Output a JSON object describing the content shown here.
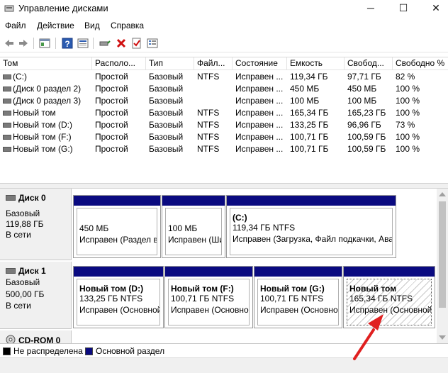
{
  "window": {
    "title": "Управление дисками",
    "minimize": "─",
    "maximize": "☐",
    "close": "✕"
  },
  "menu": [
    "Файл",
    "Действие",
    "Вид",
    "Справка"
  ],
  "volume_list": {
    "columns": [
      "Том",
      "Располо...",
      "Тип",
      "Файл...",
      "Состояние",
      "Емкость",
      "Свобод...",
      "Свободно %"
    ],
    "rows": [
      [
        "(C:)",
        "Простой",
        "Базовый",
        "NTFS",
        "Исправен ...",
        "119,34 ГБ",
        "97,71 ГБ",
        "82 %"
      ],
      [
        "(Диск 0 раздел 2)",
        "Простой",
        "Базовый",
        "",
        "Исправен ...",
        "450 МБ",
        "450 МБ",
        "100 %"
      ],
      [
        "(Диск 0 раздел 3)",
        "Простой",
        "Базовый",
        "",
        "Исправен ...",
        "100 МБ",
        "100 МБ",
        "100 %"
      ],
      [
        "Новый том",
        "Простой",
        "Базовый",
        "NTFS",
        "Исправен ...",
        "165,34 ГБ",
        "165,23 ГБ",
        "100 %"
      ],
      [
        "Новый том (D:)",
        "Простой",
        "Базовый",
        "NTFS",
        "Исправен ...",
        "133,25 ГБ",
        "96,96 ГБ",
        "73 %"
      ],
      [
        "Новый том (F:)",
        "Простой",
        "Базовый",
        "NTFS",
        "Исправен ...",
        "100,71 ГБ",
        "100,59 ГБ",
        "100 %"
      ],
      [
        "Новый том (G:)",
        "Простой",
        "Базовый",
        "NTFS",
        "Исправен ...",
        "100,71 ГБ",
        "100,59 ГБ",
        "100 %"
      ]
    ]
  },
  "disks": [
    {
      "name": "Диск 0",
      "type": "Базовый",
      "size": "119,88 ГБ",
      "status": "В сети",
      "partitions": [
        {
          "title": "",
          "size": "450 МБ",
          "status": "Исправен (Раздел в"
        },
        {
          "title": "",
          "size": "100 МБ",
          "status": "Исправен (Ши"
        },
        {
          "title": "(C:)",
          "size": "119,34 ГБ NTFS",
          "status": "Исправен (Загрузка, Файл подкачки, Ава"
        }
      ]
    },
    {
      "name": "Диск 1",
      "type": "Базовый",
      "size": "500,00 ГБ",
      "status": "В сети",
      "partitions": [
        {
          "title": "Новый том (D:)",
          "size": "133,25 ГБ NTFS",
          "status": "Исправен (Основной"
        },
        {
          "title": "Новый том (F:)",
          "size": "100,71 ГБ NTFS",
          "status": "Исправен (Основно"
        },
        {
          "title": "Новый том (G:)",
          "size": "100,71 ГБ NTFS",
          "status": "Исправен (Основно"
        },
        {
          "title": "Новый том",
          "size": "165,34 ГБ NTFS",
          "status": "Исправен (Основной"
        }
      ]
    },
    {
      "name": "CD-ROM 0"
    }
  ],
  "legend": [
    {
      "label": "Не распределена",
      "color": "#000000"
    },
    {
      "label": "Основной раздел",
      "color": "#0a0a80"
    }
  ],
  "colors": {
    "partition_bar": "#0a0a80",
    "annotation_arrow": "#e02020"
  }
}
